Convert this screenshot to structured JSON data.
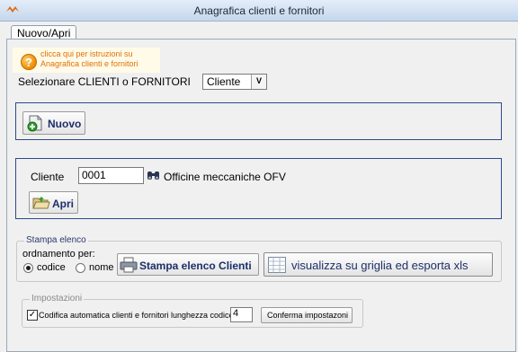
{
  "window": {
    "title": "Anagrafica clienti e fornitori"
  },
  "tabs": [
    {
      "label": "Nuovo/Apri",
      "active": true
    }
  ],
  "help": {
    "text": "clicca qui per istruzioni su Anagrafica clienti e fornitori"
  },
  "type_selector": {
    "label": "Selezionare CLIENTI o FORNITORI",
    "value": "Cliente"
  },
  "new_section": {
    "button_label": "Nuovo"
  },
  "open_section": {
    "field_label": "Cliente",
    "code_value": "0001",
    "client_name": "Officine meccaniche OFV",
    "button_label": "Apri"
  },
  "print_section": {
    "legend": "Stampa elenco",
    "order_label": "ordnamento per:",
    "options": [
      {
        "label": "codice",
        "selected": true
      },
      {
        "label": "nome",
        "selected": false
      }
    ],
    "print_button": "Stampa elenco Clienti",
    "grid_button": "visualizza su griglia ed esporta xls"
  },
  "settings_section": {
    "legend": "Impostazioni",
    "auto_code_label": "Codifica automatica clienti e fornitori",
    "auto_code_checked": true,
    "code_length_label": "lunghezza codice",
    "code_length_value": "4",
    "confirm_button": "Conferma impostazoni"
  },
  "colors": {
    "frame_border": "#2c4a8a",
    "help_text": "#e0700a",
    "button_text": "#1d2f6b"
  }
}
